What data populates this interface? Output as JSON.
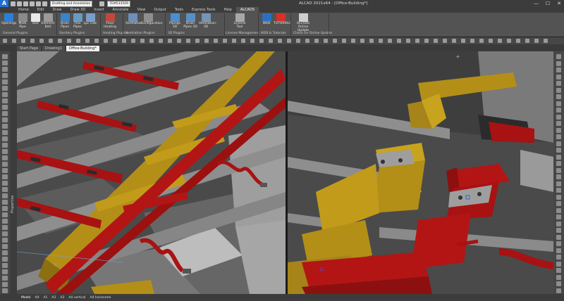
{
  "title_bar": {
    "app_logo": "A",
    "workspace": "Drafting and Annotation",
    "layer_field": "TEM533509",
    "window_title": "ALCAD 2021x64 - [Office-Building*]",
    "minimize": "—",
    "maximize": "☐",
    "close": "✕"
  },
  "menu_tabs": [
    "Home",
    "Edit",
    "Draw",
    "Draw 3D",
    "Insert",
    "Annotate",
    "View",
    "Output",
    "Tools",
    "Express Tools",
    "Help",
    "ALCADS"
  ],
  "active_menu_tab": "ALCADS",
  "ribbon": {
    "buttons": [
      {
        "label": "Openings",
        "color": "#2c7fd6"
      },
      {
        "label": "Multi Pipe",
        "color": "#8a8a8a"
      },
      {
        "label": "Text",
        "color": "#e8e8e8"
      },
      {
        "label": "Element Bolt",
        "color": "#9a9a9a"
      },
      {
        "label": "Drain Pipes",
        "color": "#3a82c9"
      },
      {
        "label": "Flex Pipes",
        "color": "#6a9ac0"
      },
      {
        "label": "Lpc Calc",
        "color": "#7a9ec6"
      },
      {
        "label": "Floor Heating",
        "color": "#c04a3a"
      },
      {
        "label": "Ventilation",
        "color": "#6d8fb8"
      },
      {
        "label": "Configuration",
        "color": "#8e8e8e"
      },
      {
        "label": "Pipings 3D",
        "color": "#4a8fd0"
      },
      {
        "label": "Drain Pipes 3D",
        "color": "#5b8ec5"
      },
      {
        "label": "Ventilation-3D",
        "color": "#7893b3"
      },
      {
        "label": "License Tool",
        "color": "#a8a8a8"
      },
      {
        "label": "WEB",
        "color": "#2c6fbf"
      },
      {
        "label": "TUTORIALS",
        "color": "#d93025"
      },
      {
        "label": "ALCADS Online Update",
        "color": "#cfcfcf"
      }
    ],
    "groups": [
      "General Plugins",
      "Sanitary Plugins",
      "Heating Plugins",
      "Ventilation Plugins",
      "3D Plugins",
      "License Management",
      "WEB & Tutorials",
      "Check for Online Update"
    ]
  },
  "doc_tabs": [
    "Start Page",
    "Drawing1",
    "Office-Building*"
  ],
  "active_doc_tab": "Office-Building*",
  "properties_label": "Properties",
  "bottom_tabs": [
    "Model",
    "A0",
    "A1",
    "A2",
    "A3",
    "A4 vertical",
    "A4 horizontal"
  ],
  "colors": {
    "duct": "#b0901a",
    "pipe": "#b01818",
    "wall": "#707070",
    "beam": "#9a9a9a",
    "floor": "#555555"
  }
}
